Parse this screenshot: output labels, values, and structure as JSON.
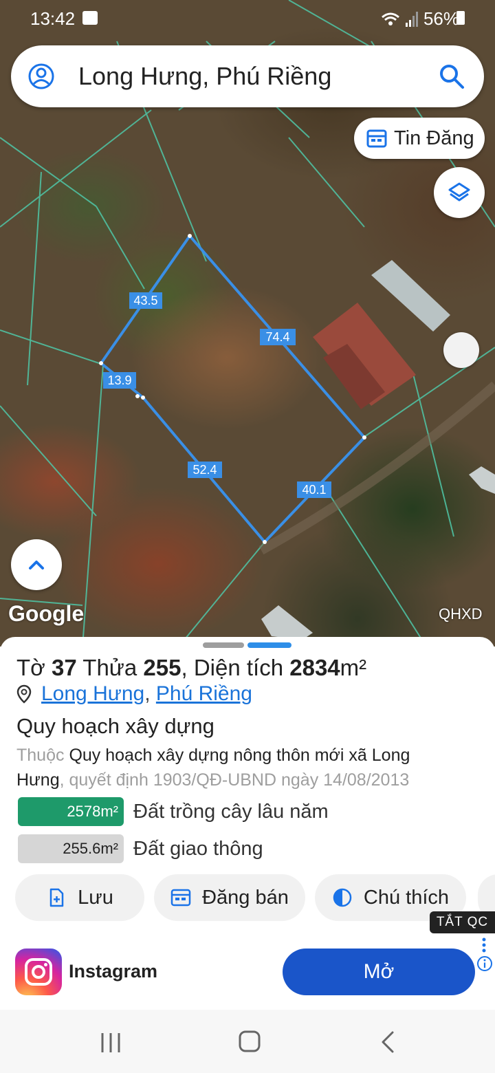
{
  "status_bar": {
    "time": "13:42",
    "battery": "56%"
  },
  "search": {
    "query": "Long Hưng, Phú Riềng"
  },
  "map": {
    "tin_dang_label": "Tin Đăng",
    "google_logo": "Google",
    "layer_label": "QHXD",
    "edge_labels": [
      "43.5",
      "74.4",
      "13.9",
      "52.4",
      "40.1"
    ],
    "parcel_outline_color": "#3a8fe6"
  },
  "parcel": {
    "sheet_prefix": "Tờ",
    "sheet_no": "37",
    "plot_prefix": "Thửa",
    "plot_no": "255",
    "area_prefix": ", Diện tích",
    "area_value": "2834",
    "area_unit": "m²",
    "commune": "Long Hưng",
    "separator": ",",
    "district": "Phú Riềng"
  },
  "planning": {
    "title": "Quy hoạch xây dựng",
    "desc_prefix": "Thuộc",
    "desc_main": "Quy hoạch xây dựng nông thôn mới xã Long Hưng",
    "desc_suffix": ", quyết định 1903/QĐ-UBND  ngày 14/08/2013"
  },
  "land_uses": [
    {
      "area": "2578m²",
      "type": "Đất trồng cây lâu năm",
      "color": "#1e9a6a"
    },
    {
      "area": "255.6m²",
      "type": "Đất giao thông",
      "color": "#d6d6d6"
    }
  ],
  "actions": {
    "save": "Lưu",
    "sell": "Đăng bán",
    "legend": "Chú thích"
  },
  "ad": {
    "close_tag": "TẮT QC",
    "app_name": "Instagram",
    "open_label": "Mở"
  },
  "icons": [
    "account-icon",
    "search-icon",
    "calendar-icon",
    "layers-icon",
    "chevron-up-icon",
    "pin-icon",
    "add-file-icon",
    "contrast-icon",
    "info-icon"
  ]
}
